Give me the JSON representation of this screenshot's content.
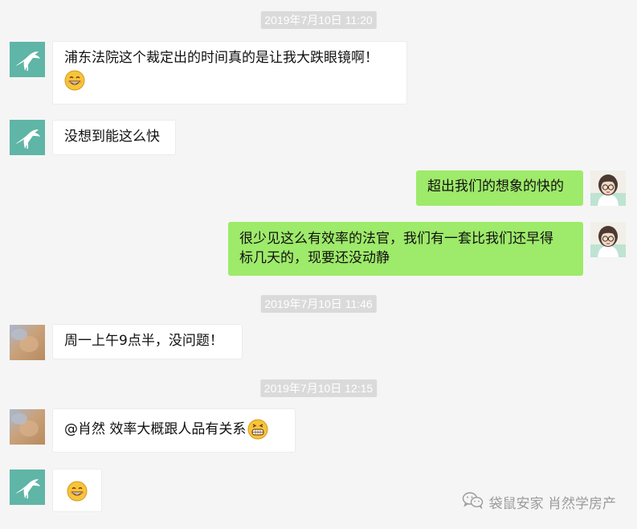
{
  "timestamps": {
    "t1": "2019年7月10日 11:20",
    "t2": "2019年7月10日 11:46",
    "t3": "2019年7月10日 12:15"
  },
  "messages": {
    "m1": "浦东法院这个裁定出的时间真的是让我大跌眼镜啊！",
    "m2": "没想到能这么快",
    "m3": "超出我们的想象的快的",
    "m4_line1": "很少见这么有效率的法官，我们有一套比我们还早得",
    "m4_line2": "标几天的，现要还没动静",
    "m5": "周一上午9点半，没问题！",
    "m6": "@肖然 效率大概跟人品有关系"
  },
  "watermark": {
    "text": "袋鼠安家 肖然学房产",
    "icon": "wechat-icon"
  },
  "colors": {
    "background": "#f5f5f5",
    "left_bubble": "#ffffff",
    "right_bubble": "#9eea6a",
    "timestamp_bg": "#dadada",
    "teal_avatar": "#5fb5a6"
  },
  "icons": {
    "teal_avatar": "kangaroo-logo-icon",
    "cartoon_avatar": "cartoon-woman-avatar-icon",
    "blurred_avatar": "blurred-photo-avatar-icon",
    "emoji_grin": "grinning-emoji-icon",
    "emoji_big_grin": "big-grin-emoji-icon"
  }
}
